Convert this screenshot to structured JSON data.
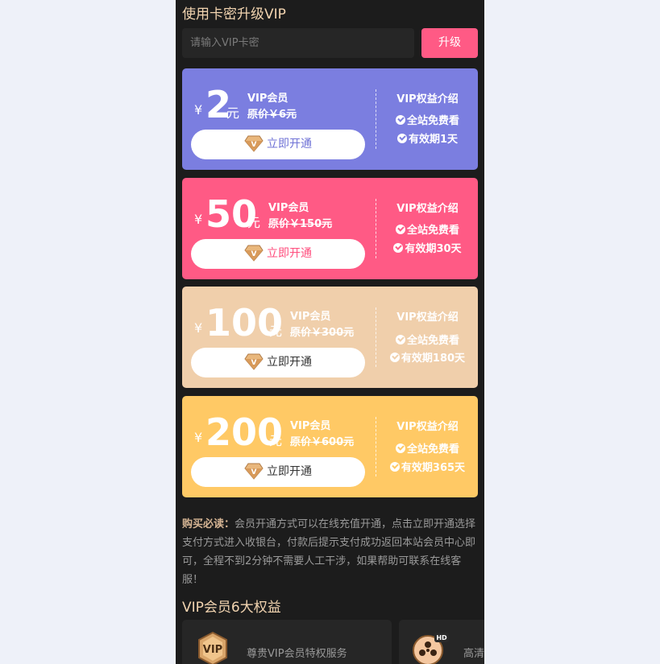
{
  "header": {
    "title": "使用卡密升级VIP"
  },
  "redeem": {
    "placeholder": "请输入VIP卡密",
    "button_label": "升级"
  },
  "plans": [
    {
      "yen": "¥",
      "price": "2",
      "unit": "元",
      "name": "VIP会员",
      "original": "原价￥6元",
      "button_label": "立即开通",
      "benefits_title": "VIP权益介绍",
      "benefit_1": "全站免费看",
      "benefit_2": "有效期1天",
      "color": "#7b7ee0",
      "button_text_color": "#6f72d6"
    },
    {
      "yen": "¥",
      "price": "50",
      "unit": "元",
      "name": "VIP会员",
      "original": "原价￥150元",
      "button_label": "立即开通",
      "benefits_title": "VIP权益介绍",
      "benefit_1": "全站免费看",
      "benefit_2": "有效期30天",
      "color": "#ff5a85",
      "button_text_color": "#ff4d7d"
    },
    {
      "yen": "¥",
      "price": "100",
      "unit": "元",
      "name": "VIP会员",
      "original": "原价￥300元",
      "button_label": "立即开通",
      "benefits_title": "VIP权益介绍",
      "benefit_1": "全站免费看",
      "benefit_2": "有效期180天",
      "color": "#f0cfab",
      "button_text_color": "#333333"
    },
    {
      "yen": "¥",
      "price": "200",
      "unit": "元",
      "name": "VIP会员",
      "original": "原价￥600元",
      "button_label": "立即开通",
      "benefits_title": "VIP权益介绍",
      "benefit_1": "全站免费看",
      "benefit_2": "有效期365天",
      "color": "#ffc965",
      "button_text_color": "#333333"
    }
  ],
  "notice": {
    "label": "购买必读：",
    "text": "会员开通方式可以在线充值开通，点击立即开通选择支付方式进入收银台，付款后提示支付成功返回本站会员中心即可，全程不到2分钟不需要人工干涉，如果帮助可联系在线客服！"
  },
  "benefits_section": {
    "title": "VIP会员6大权益",
    "cards": [
      {
        "icon": "vip-badge-icon",
        "icon_text": "VIP",
        "text": "尊贵VIP会员特权服务"
      },
      {
        "icon": "hd-video-icon",
        "icon_text": "HD",
        "text": "高清"
      }
    ]
  }
}
